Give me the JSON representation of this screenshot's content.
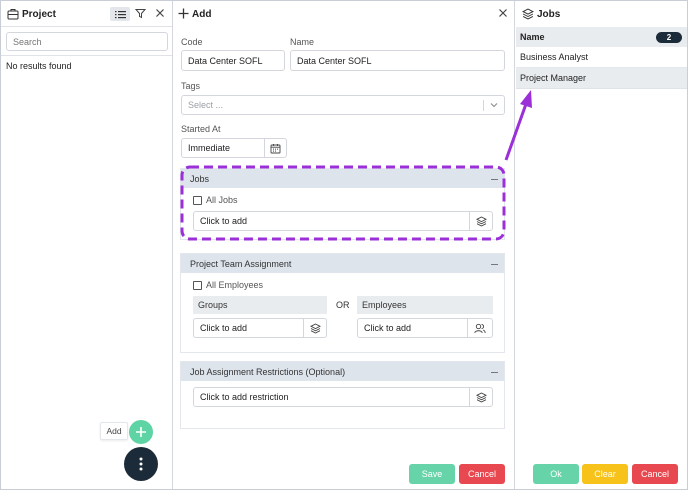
{
  "left_panel": {
    "title": "Project",
    "search_placeholder": "Search",
    "empty_text": "No results found",
    "add_tooltip": "Add"
  },
  "mid_panel": {
    "title": "Add",
    "code_label": "Code",
    "code_value": "Data Center SOFL",
    "name_label": "Name",
    "name_value": "Data Center SOFL",
    "tags_label": "Tags",
    "tags_placeholder": "Select ...",
    "started_label": "Started At",
    "started_value": "Immediate",
    "jobs_section": {
      "title": "Jobs",
      "all_label": "All Jobs",
      "click_to_add": "Click to add"
    },
    "team_section": {
      "title": "Project Team Assignment",
      "all_label": "All Employees",
      "groups_label": "Groups",
      "or_label": "OR",
      "employees_label": "Employees",
      "groups_add": "Click to add",
      "employees_add": "Click to add"
    },
    "restrictions_section": {
      "title": "Job Assignment Restrictions (Optional)",
      "click_to_add": "Click to add restriction"
    },
    "save_label": "Save",
    "cancel_label": "Cancel"
  },
  "right_panel": {
    "title": "Jobs",
    "column_name": "Name",
    "count": "2",
    "items": [
      "Business Analyst",
      "Project Manager"
    ],
    "ok_label": "Ok",
    "clear_label": "Clear",
    "cancel_label": "Cancel"
  },
  "colors": {
    "annotation": "#9b30d9",
    "save": "#66d4a8",
    "cancel": "#e8484f",
    "clear": "#f7c21a",
    "section_header": "#dde4ec",
    "fab_dark": "#1c2b39",
    "add_green": "#5ed3a3"
  }
}
